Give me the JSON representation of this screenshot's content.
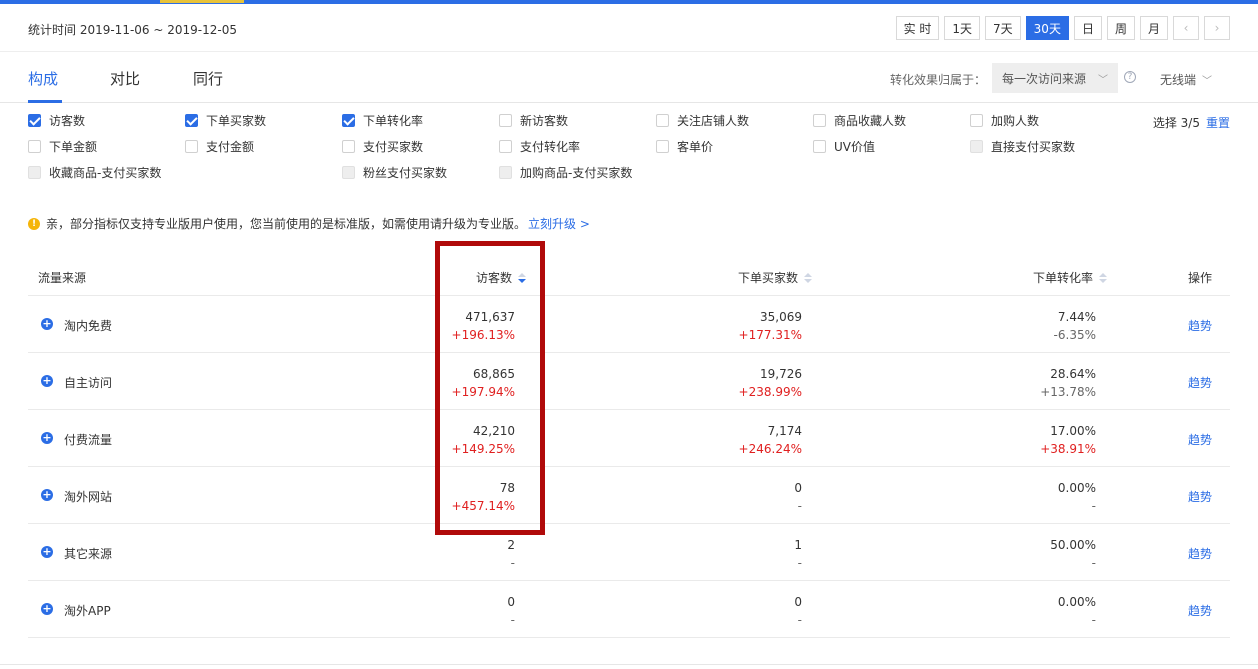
{
  "header": {
    "stat_label": "统计时间 2019-11-06 ~ 2019-12-05",
    "ranges": [
      "实 时",
      "1天",
      "7天",
      "30天",
      "日",
      "周",
      "月"
    ],
    "active_range": "30天",
    "prev": "‹",
    "next": "›"
  },
  "tabs": [
    {
      "label": "构成",
      "active": true
    },
    {
      "label": "对比",
      "active": false
    },
    {
      "label": "同行",
      "active": false
    }
  ],
  "attribution": {
    "label": "转化效果归属于：",
    "value": "每一次访问来源",
    "help": "?",
    "device": "无线端"
  },
  "metrics": [
    {
      "label": "访客数",
      "state": "checked"
    },
    {
      "label": "下单买家数",
      "state": "checked"
    },
    {
      "label": "下单转化率",
      "state": "checked"
    },
    {
      "label": "新访客数",
      "state": "unchecked"
    },
    {
      "label": "关注店铺人数",
      "state": "unchecked"
    },
    {
      "label": "商品收藏人数",
      "state": "unchecked"
    },
    {
      "label": "加购人数",
      "state": "unchecked"
    },
    {
      "label": "下单金额",
      "state": "unchecked"
    },
    {
      "label": "支付金额",
      "state": "unchecked"
    },
    {
      "label": "支付买家数",
      "state": "unchecked"
    },
    {
      "label": "支付转化率",
      "state": "unchecked"
    },
    {
      "label": "客单价",
      "state": "unchecked"
    },
    {
      "label": "UV价值",
      "state": "unchecked"
    },
    {
      "label": "直接支付买家数",
      "state": "disabled"
    },
    {
      "label": "收藏商品-支付买家数",
      "state": "disabled"
    },
    {
      "label": "粉丝支付买家数",
      "state": "disabled"
    },
    {
      "label": "加购商品-支付买家数",
      "state": "disabled"
    }
  ],
  "selection": {
    "count": "选择 3/5",
    "reset": "重置"
  },
  "notice": {
    "text": "亲，部分指标仅支持专业版用户使用，您当前使用的是标准版，如需使用请升级为专业版。",
    "link": "立刻升级 >"
  },
  "table": {
    "headers": {
      "source": "流量来源",
      "visitors": "访客数",
      "buyers": "下单买家数",
      "rate": "下单转化率",
      "action": "操作"
    },
    "rows": [
      {
        "source": "淘内免费",
        "visitors": "471,637",
        "visitors_change": "+196.13%",
        "buyers": "35,069",
        "buyers_change": "+177.31%",
        "rate": "7.44%",
        "rate_change": "-6.35%",
        "action": "趋势"
      },
      {
        "source": "自主访问",
        "visitors": "68,865",
        "visitors_change": "+197.94%",
        "buyers": "19,726",
        "buyers_change": "+238.99%",
        "rate": "28.64%",
        "rate_change": "+13.78%",
        "action": "趋势"
      },
      {
        "source": "付费流量",
        "visitors": "42,210",
        "visitors_change": "+149.25%",
        "buyers": "7,174",
        "buyers_change": "+246.24%",
        "rate": "17.00%",
        "rate_change": "+38.91%",
        "action": "趋势"
      },
      {
        "source": "淘外网站",
        "visitors": "78",
        "visitors_change": "+457.14%",
        "buyers": "0",
        "buyers_change": "-",
        "rate": "0.00%",
        "rate_change": "-",
        "action": "趋势"
      },
      {
        "source": "其它来源",
        "visitors": "2",
        "visitors_change": "-",
        "buyers": "1",
        "buyers_change": "-",
        "rate": "50.00%",
        "rate_change": "-",
        "action": "趋势"
      },
      {
        "source": "淘外APP",
        "visitors": "0",
        "visitors_change": "-",
        "buyers": "0",
        "buyers_change": "-",
        "rate": "0.00%",
        "rate_change": "-",
        "action": "趋势"
      }
    ]
  },
  "colors": {
    "accent": "#2b6de5",
    "positive": "#e02020",
    "highlight_box": "#b00a0a"
  }
}
